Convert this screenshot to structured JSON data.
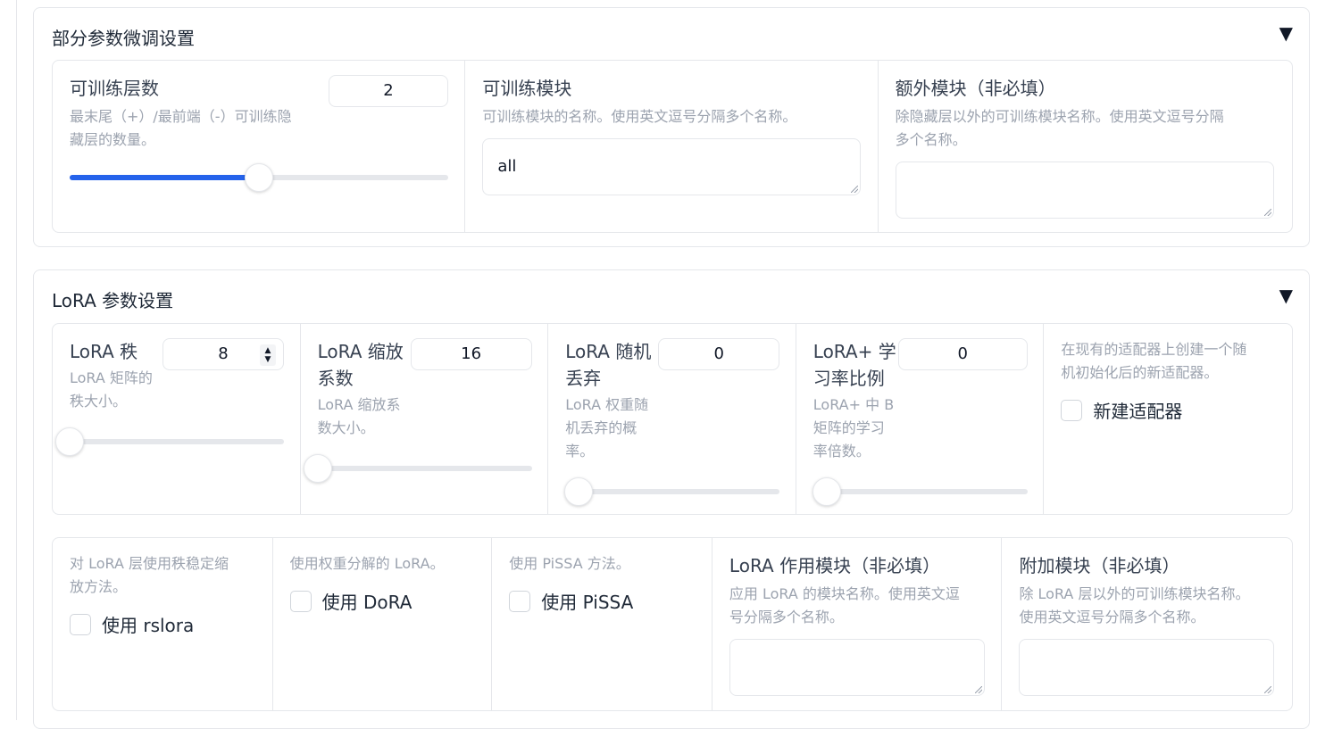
{
  "section_partial": {
    "title": "部分参数微调设置",
    "toggle": "▼",
    "num_layers": {
      "label": "可训练层数",
      "info": [
        "最末尾（+）/最前端（-）可训练隐",
        "藏层的数量。"
      ],
      "value": "2",
      "fraction": 0.5
    },
    "train_modules": {
      "label": "可训练模块",
      "info": [
        "可训练模块的名称。使用英文逗号分隔多个名称。"
      ],
      "value": "all"
    },
    "extra_modules": {
      "label": "额外模块（非必填）",
      "info": [
        "除隐藏层以外的可训练模块名称。使用英文逗号分隔",
        "多个名称。"
      ],
      "value": ""
    }
  },
  "section_lora": {
    "title": "LoRA 参数设置",
    "toggle": "▼",
    "rank": {
      "label": [
        "LoRA 秩"
      ],
      "info": [
        "LoRA 矩阵的",
        "秩大小。"
      ],
      "value": "8",
      "fraction": 0.0,
      "spin_up": "▲",
      "spin_down": "▼"
    },
    "alpha": {
      "label": [
        "LoRA 缩放",
        "系数"
      ],
      "info": [
        "LoRA 缩放系",
        "数大小。"
      ],
      "value": "16",
      "fraction": 0.0
    },
    "dropout": {
      "label": [
        "LoRA 随机",
        "丢弃"
      ],
      "info": [
        "LoRA 权重随",
        "机丢弃的概",
        "率。"
      ],
      "value": "0",
      "fraction": 0.0
    },
    "plus_ratio": {
      "label": [
        "LoRA+ 学",
        "习率比例"
      ],
      "info": [
        "LoRA+ 中 B",
        "矩阵的学习",
        "率倍数。"
      ],
      "value": "0",
      "fraction": 0.0
    },
    "create_new_adapter": {
      "info": [
        "在现有的适配器上创建一个随",
        "机初始化后的新适配器。"
      ],
      "label": "新建适配器",
      "checked": false
    },
    "use_rslora": {
      "info": [
        "对 LoRA 层使用秩稳定缩",
        "放方法。"
      ],
      "label": "使用 rslora",
      "checked": false
    },
    "use_dora": {
      "info": [
        "使用权重分解的 LoRA。"
      ],
      "label": "使用 DoRA",
      "checked": false
    },
    "use_pissa": {
      "info": [
        "使用 PiSSA 方法。"
      ],
      "label": "使用 PiSSA",
      "checked": false
    },
    "target_modules": {
      "label": "LoRA 作用模块（非必填）",
      "info": [
        "应用 LoRA 的模块名称。使用英文逗",
        "号分隔多个名称。"
      ],
      "value": ""
    },
    "additional_target": {
      "label": "附加模块（非必填）",
      "info": [
        "除 LoRA 层以外的可训练模块名称。",
        "使用英文逗号分隔多个名称。"
      ],
      "value": ""
    }
  },
  "colors": {
    "accent": "#2563eb",
    "border": "#e5e7eb",
    "info_text": "#9ca3af"
  }
}
